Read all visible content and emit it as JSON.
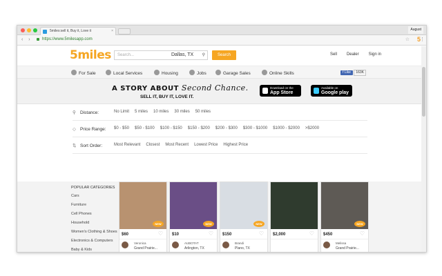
{
  "browser": {
    "tab_title": "5miles:sell it, Buy it, Love it",
    "tab_close": "×",
    "profile": "August",
    "url": "https://www.5milesapp.com",
    "nav_glyphs": "‹ ›",
    "star": "☆",
    "ext_icon": "5",
    "menu": "⋮",
    "lights": [
      "#fc5f57",
      "#fdbc2e",
      "#28c840"
    ]
  },
  "header": {
    "logo": "5miles",
    "search_placeholder": "Search...",
    "city": "Dallas, TX",
    "pin": "⚲",
    "search_button": "Search",
    "links": [
      "Sell",
      "Dealer",
      "Sign in"
    ]
  },
  "categories": [
    {
      "label": "For Sale",
      "icon": "tag-icon"
    },
    {
      "label": "Local Services",
      "icon": "handshake-icon"
    },
    {
      "label": "Housing",
      "icon": "house-icon"
    },
    {
      "label": "Jobs",
      "icon": "briefcase-icon"
    },
    {
      "label": "Garage Sales",
      "icon": "garage-icon"
    },
    {
      "label": "Online Skills",
      "icon": "laptop-icon"
    }
  ],
  "facebook": {
    "like": "f Like",
    "count": "163K"
  },
  "banner": {
    "headline": "A STORY ABOUT",
    "script": "Second Chance.",
    "tagline": "SELL IT, BUY IT, LOVE IT.",
    "appstore": {
      "small": "Download on the",
      "big": "App Store"
    },
    "googleplay": {
      "small": "Available on",
      "big": "Google play"
    }
  },
  "filters": {
    "distance": {
      "label": "Distance:",
      "options": [
        "No Limit",
        "5 miles",
        "10 miles",
        "30 miles",
        "50 miles"
      ]
    },
    "price": {
      "label": "Price Range:",
      "options": [
        "$0 - $50",
        "$50 - $100",
        "$100 - $150",
        "$150 - $200",
        "$200 - $300",
        "$300 - $1000",
        "$1000 - $2000",
        ">$2000"
      ]
    },
    "sort": {
      "label": "Sort Order:",
      "options": [
        "Most Relevant",
        "Closest",
        "Most Recent",
        "Lowest Price",
        "Highest Price"
      ]
    }
  },
  "sidebar": {
    "title": "POPULAR CATEGORIES",
    "items": [
      "Cars",
      "Furniture",
      "Cell Phones",
      "Household",
      "Women's Clothing & Shoes",
      "Electronics & Computers",
      "Baby & Kids",
      "Auto Parts"
    ]
  },
  "listings": [
    {
      "price": "$60",
      "user": "Veronica",
      "location": "Grand Prairie...",
      "new": "NEW",
      "img": "#b89270",
      "img2": "#d8b89a"
    },
    {
      "price": "$10",
      "user": "AUBOTAT",
      "location": "Arlington, TX",
      "new": "NEW",
      "img": "#6a4e86",
      "img2": "#c8342f"
    },
    {
      "price": "$150",
      "user": "Brandi",
      "location": "Plano, TX",
      "new": "NEW",
      "img": "#d8dde3",
      "img2": "#5a6f86"
    },
    {
      "price": "$2,000",
      "user": "",
      "location": "",
      "new": "",
      "img": "#2f3b2e",
      "img2": "#222222"
    },
    {
      "price": "$450",
      "user": "Melissa",
      "location": "Grand Prairie...",
      "new": "NEW",
      "img": "#5e5a55",
      "img2": "#cfd2d4"
    }
  ],
  "listing_badge_2": "$20"
}
